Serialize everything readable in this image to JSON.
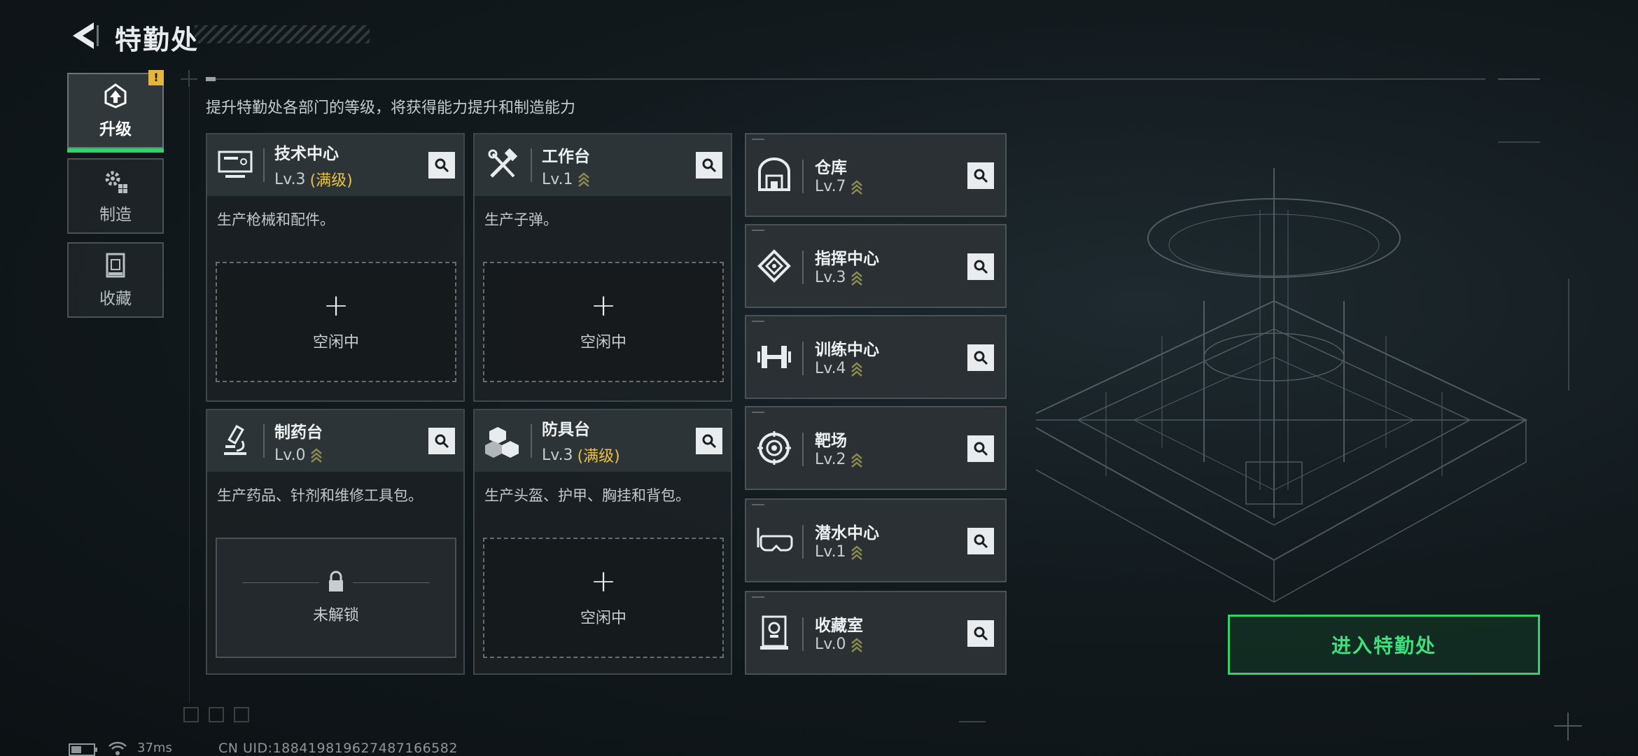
{
  "header": {
    "title": "特勤处"
  },
  "sidebar": {
    "alert_badge": "!",
    "tabs": [
      {
        "label": "升级",
        "icon": "upgrade-icon",
        "active": true
      },
      {
        "label": "制造",
        "icon": "gears-icon",
        "active": false
      },
      {
        "label": "收藏",
        "icon": "collection-icon",
        "active": false
      }
    ]
  },
  "hint": "提升特勤处各部门的等级，将获得能力提升和制造能力",
  "departments": [
    {
      "name": "技术中心",
      "level": "Lv.3",
      "max": "(满级)",
      "icon": "monitor-icon",
      "desc": "生产枪械和配件。",
      "slot": {
        "plus": "+",
        "status": "空闲中"
      }
    },
    {
      "name": "工作台",
      "level": "Lv.1",
      "max": "",
      "icon": "tools-icon",
      "desc": "生产子弹。",
      "slot": {
        "plus": "+",
        "status": "空闲中"
      }
    },
    {
      "name": "制药台",
      "level": "Lv.0",
      "max": "",
      "icon": "microscope-icon",
      "desc": "生产药品、针剂和维修工具包。",
      "slot": {
        "status": "未解锁"
      }
    },
    {
      "name": "防具台",
      "level": "Lv.3",
      "max": "(满级)",
      "icon": "armor-boxes-icon",
      "desc": "生产头盔、护甲、胸挂和背包。",
      "slot": {
        "plus": "+",
        "status": "空闲中"
      }
    }
  ],
  "facilities": [
    {
      "name": "仓库",
      "level": "Lv.7",
      "icon": "warehouse-icon"
    },
    {
      "name": "指挥中心",
      "level": "Lv.3",
      "icon": "chip-icon"
    },
    {
      "name": "训练中心",
      "level": "Lv.4",
      "icon": "dumbbell-icon"
    },
    {
      "name": "靶场",
      "level": "Lv.2",
      "icon": "target-icon"
    },
    {
      "name": "潜水中心",
      "level": "Lv.1",
      "icon": "diving-mask-icon"
    },
    {
      "name": "收藏室",
      "level": "Lv.0",
      "icon": "trophy-case-icon"
    }
  ],
  "enter_button": "进入特勤处",
  "status_bar": {
    "ping": "37ms",
    "uid": "CN UID:18841981962748716658​2"
  },
  "colors": {
    "accent": "#2fd36b",
    "max_level": "#e6c24a",
    "upgrade_chevron": "#8a8a4e"
  }
}
